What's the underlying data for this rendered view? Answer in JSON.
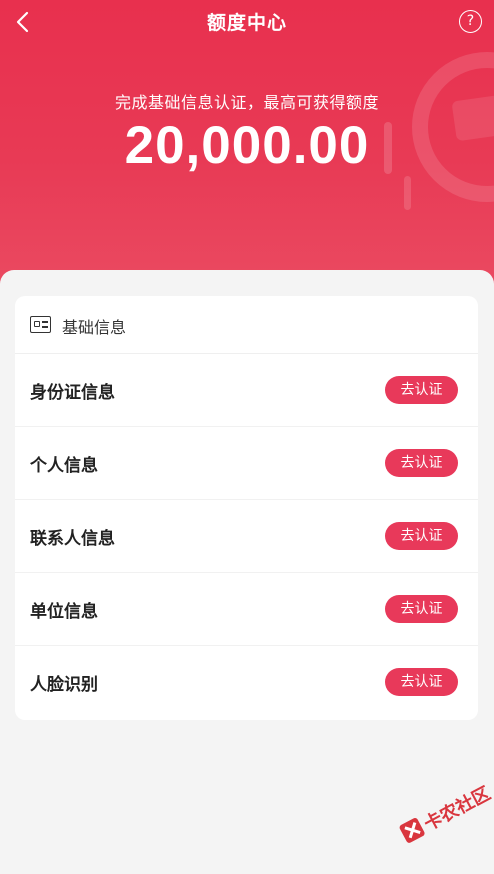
{
  "nav": {
    "title": "额度中心",
    "back_icon": "chevron-left-icon",
    "help_icon": "question-circle-icon",
    "help_glyph": "?"
  },
  "hero": {
    "subtitle": "完成基础信息认证，最高可获得额度",
    "amount": "20,000.00"
  },
  "card": {
    "title": "基础信息",
    "header_icon": "id-card-icon",
    "items": [
      {
        "label": "身份证信息",
        "button": "去认证"
      },
      {
        "label": "个人信息",
        "button": "去认证"
      },
      {
        "label": "联系人信息",
        "button": "去认证"
      },
      {
        "label": "单位信息",
        "button": "去认证"
      },
      {
        "label": "人脸识别",
        "button": "去认证"
      }
    ]
  },
  "watermark": {
    "text": "卡农社区"
  },
  "colors": {
    "brand_red": "#e8304e",
    "button_red": "#e8395a",
    "background": "#f4f4f4"
  }
}
